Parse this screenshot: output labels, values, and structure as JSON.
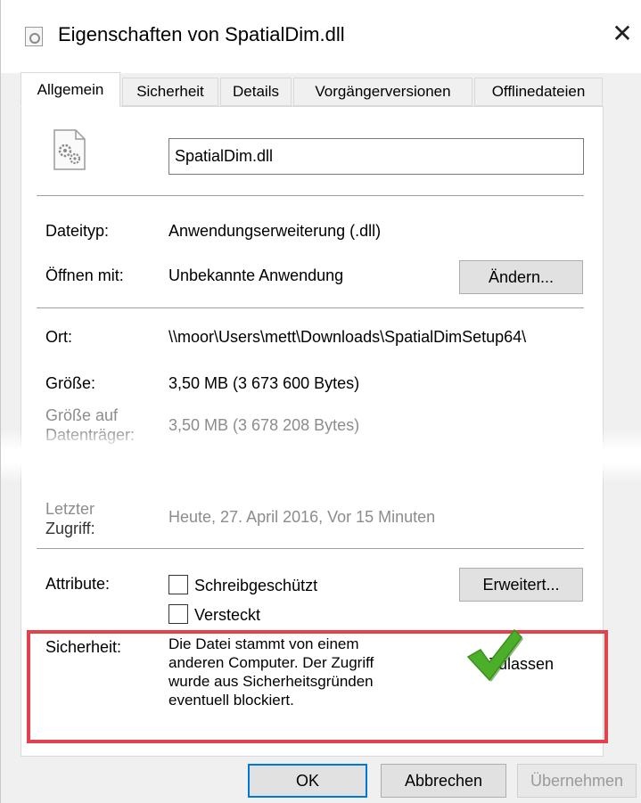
{
  "window": {
    "title": "Eigenschaften von SpatialDim.dll"
  },
  "tabs": [
    {
      "label": "Allgemein",
      "active": true
    },
    {
      "label": "Sicherheit",
      "active": false
    },
    {
      "label": "Details",
      "active": false
    },
    {
      "label": "Vorgängerversionen",
      "active": false
    },
    {
      "label": "Offlinedateien",
      "active": false
    }
  ],
  "file": {
    "name": "SpatialDim.dll",
    "icon": "dll-file-icon"
  },
  "general": {
    "filetype_label": "Dateityp:",
    "filetype_value": "Anwendungserweiterung (.dll)",
    "openwith_label": "Öffnen mit:",
    "openwith_value": "Unbekannte Anwendung",
    "change_button": "Ändern...",
    "location_label": "Ort:",
    "location_value": "\\\\moor\\Users\\mett\\Downloads\\SpatialDimSetup64\\",
    "size_label": "Größe:",
    "size_value": "3,50 MB (3 673 600 Bytes)",
    "sizeondisk_label_line1": "Größe auf",
    "sizeondisk_label_line2": "Datenträger:",
    "sizeondisk_value": "3,50 MB (3 678 208 Bytes)",
    "accessed_label_line1": "Letzter",
    "accessed_label_line2": "Zugriff:",
    "accessed_value": "Heute, 27. April 2016, Vor 15 Minuten",
    "attributes_label": "Attribute:",
    "readonly_label": "Schreibgeschützt",
    "readonly_checked": false,
    "hidden_label": "Versteckt",
    "hidden_checked": false,
    "advanced_button": "Erweitert..."
  },
  "security": {
    "label": "Sicherheit:",
    "text_line1": "Die Datei stammt von einem",
    "text_line2": "anderen Computer. Der Zugriff",
    "text_line3": "wurde aus Sicherheitsgründen",
    "text_line4": "eventuell blockiert.",
    "unblock_label": "Zulassen",
    "highlight_color": "#e2424c",
    "check_color": "#4caf2a"
  },
  "buttons": {
    "ok": "OK",
    "cancel": "Abbrechen",
    "apply": "Übernehmen"
  }
}
